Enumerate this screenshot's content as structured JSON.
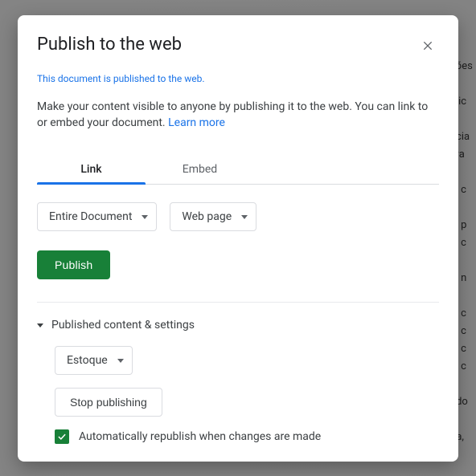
{
  "dialog": {
    "title": "Publish to the web",
    "status": "This document is published to the web.",
    "description_a": "Make your content visible to anyone by publishing it to the web. You can link to or embed your document. ",
    "learn_more": "Learn more"
  },
  "tabs": {
    "link": "Link",
    "embed": "Embed"
  },
  "selects": {
    "scope": "Entire Document",
    "format": "Web page"
  },
  "buttons": {
    "publish": "Publish",
    "stop": "Stop publishing"
  },
  "section": {
    "title": "Published content & settings",
    "sheet": "Estoque",
    "auto_republish": "Automatically republish when changes are made"
  }
}
